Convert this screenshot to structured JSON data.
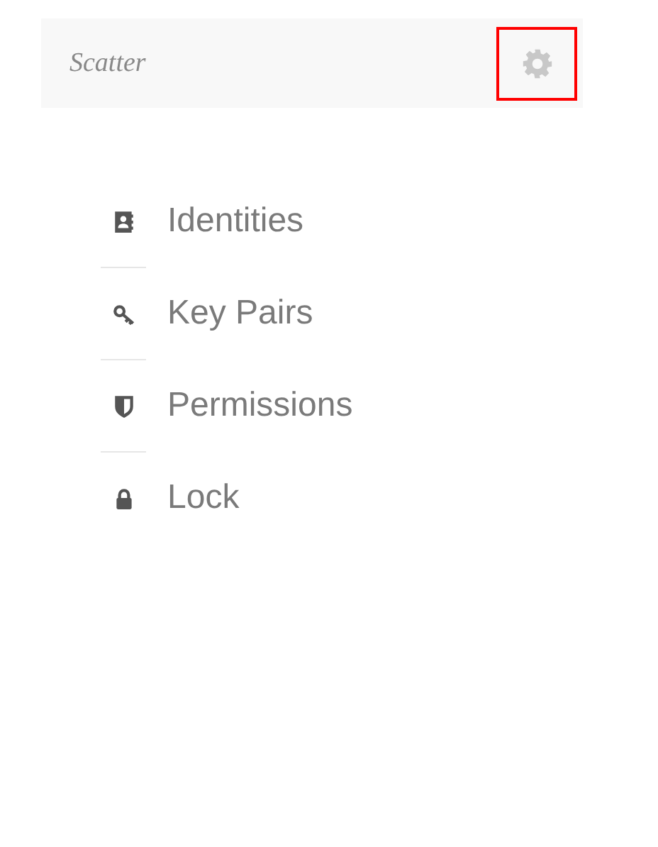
{
  "header": {
    "title": "Scatter",
    "settings_button": {
      "highlighted": true
    }
  },
  "menu": [
    {
      "label": "Identities"
    },
    {
      "label": "Key Pairs"
    },
    {
      "label": "Permissions"
    },
    {
      "label": "Lock"
    }
  ]
}
